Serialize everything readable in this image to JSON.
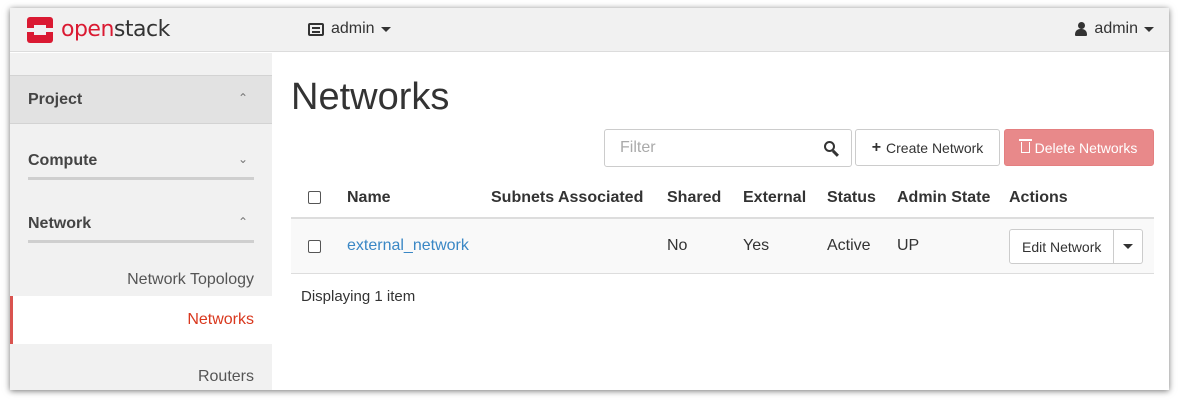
{
  "brand": {
    "open": "open",
    "stack": "stack"
  },
  "topbar": {
    "project_label": "admin",
    "user_label": "admin"
  },
  "sidebar": {
    "sections": [
      {
        "label": "Project",
        "chevron": "up"
      },
      {
        "label": "Compute",
        "chevron": "down"
      },
      {
        "label": "Network",
        "chevron": "up"
      }
    ],
    "items": [
      {
        "label": "Network Topology",
        "active": false
      },
      {
        "label": "Networks",
        "active": true
      },
      {
        "label": "Routers",
        "active": false
      }
    ]
  },
  "page": {
    "title": "Networks"
  },
  "toolbar": {
    "filter_placeholder": "Filter",
    "filter_value": "",
    "create_label": "Create Network",
    "delete_label": "Delete Networks"
  },
  "table": {
    "columns": [
      "Name",
      "Subnets Associated",
      "Shared",
      "External",
      "Status",
      "Admin State",
      "Actions"
    ],
    "rows": [
      {
        "name": "external_network",
        "subnets": "",
        "shared": "No",
        "external": "Yes",
        "status": "Active",
        "admin_state": "UP",
        "action_label": "Edit Network"
      }
    ],
    "footer": "Displaying 1 item"
  },
  "colors": {
    "accent": "#da1a32",
    "link": "#3a87c5",
    "danger": "#e8898a",
    "active_item": "#d9381e"
  },
  "icons": [
    "openstack-logo-icon",
    "project-icon",
    "user-icon",
    "search-icon",
    "plus-icon",
    "trash-icon",
    "chevron-up-icon",
    "chevron-down-icon",
    "caret-down-icon"
  ]
}
